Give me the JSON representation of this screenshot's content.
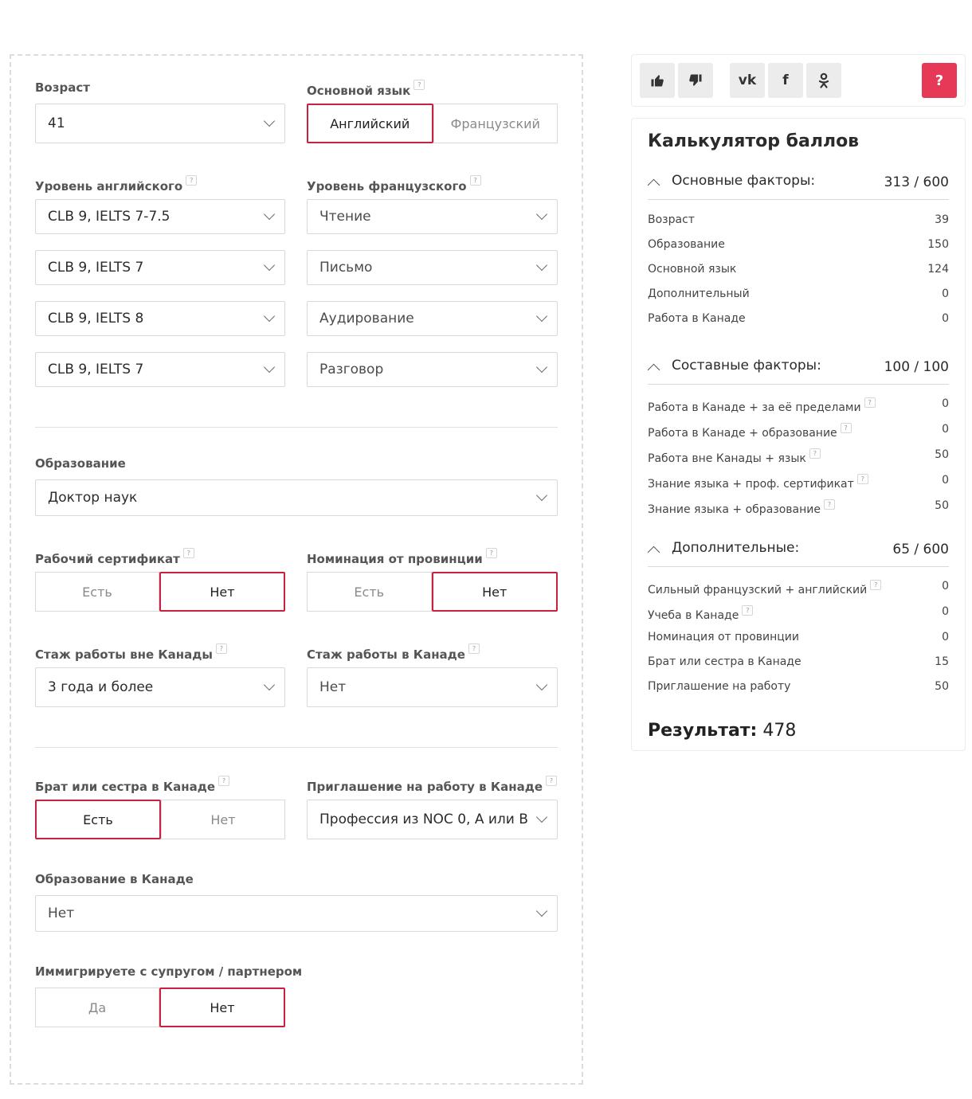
{
  "form": {
    "age": {
      "label": "Возраст",
      "value": "41"
    },
    "main_language": {
      "label": "Основной язык",
      "options": [
        "Английский",
        "Французский"
      ],
      "selected": "Английский"
    },
    "english_level": {
      "label": "Уровень английского",
      "values": [
        "CLB 9, IELTS 7-7.5",
        "CLB 9, IELTS 7",
        "CLB 9, IELTS 8",
        "CLB 9, IELTS 7"
      ]
    },
    "french_level": {
      "label": "Уровень французского",
      "values": [
        "Чтение",
        "Письмо",
        "Аудирование",
        "Разговор"
      ]
    },
    "education": {
      "label": "Образование",
      "value": "Доктор наук"
    },
    "work_certificate": {
      "label": "Рабочий сертификат",
      "options": [
        "Есть",
        "Нет"
      ],
      "selected": "Нет"
    },
    "provincial_nomination": {
      "label": "Номинация от провинции",
      "options": [
        "Есть",
        "Нет"
      ],
      "selected": "Нет"
    },
    "foreign_experience": {
      "label": "Стаж работы вне Канады",
      "value": "3 года и более"
    },
    "canadian_experience": {
      "label": "Стаж работы в Канаде",
      "value": "Нет"
    },
    "sibling_in_canada": {
      "label": "Брат или сестра в Канаде",
      "options": [
        "Есть",
        "Нет"
      ],
      "selected": "Есть"
    },
    "job_offer": {
      "label": "Приглашение на работу в Канаде",
      "value": "Профессия из NOC 0, A или B"
    },
    "canadian_education": {
      "label": "Образование в Канаде",
      "value": "Нет"
    },
    "spouse": {
      "label": "Иммигрируете с супругом / партнером",
      "options": [
        "Да",
        "Нет"
      ],
      "selected": "Нет"
    }
  },
  "toolbar": {
    "like_icon": "thumbs-up-icon",
    "dislike_icon": "thumbs-down-icon",
    "vk_label": "vk",
    "fb_label": "f",
    "ok_label": "ok",
    "help_label": "?"
  },
  "calculator": {
    "title": "Калькулятор баллов",
    "sections": [
      {
        "name": "Основные факторы:",
        "total": "313 / 600",
        "rows": [
          {
            "name": "Возраст",
            "value": "39"
          },
          {
            "name": "Образование",
            "value": "150"
          },
          {
            "name": "Основной язык",
            "value": "124"
          },
          {
            "name": "Дополнительный",
            "value": "0"
          },
          {
            "name": "Работа в Канаде",
            "value": "0"
          }
        ]
      },
      {
        "name": "Составные факторы:",
        "total": "100 / 100",
        "rows": [
          {
            "name": "Работа в Канаде + за её пределами",
            "value": "0"
          },
          {
            "name": "Работа в Канаде + образование",
            "value": "0"
          },
          {
            "name": "Работа вне Канады + язык",
            "value": "50"
          },
          {
            "name": "Знание языка + проф. сертификат",
            "value": "0"
          },
          {
            "name": "Знание языка + образование",
            "value": "50"
          }
        ]
      },
      {
        "name": "Дополнительные:",
        "total": "65 / 600",
        "rows": [
          {
            "name": "Сильный французский + английский",
            "value": "0"
          },
          {
            "name": "Учеба в Канаде",
            "value": "0"
          },
          {
            "name": "Номинация от провинции",
            "value": "0"
          },
          {
            "name": "Брат или сестра в Канаде",
            "value": "15"
          },
          {
            "name": "Приглашение на работу",
            "value": "50"
          }
        ]
      }
    ],
    "result_label": "Результат:",
    "result_value": "478"
  },
  "colors": {
    "accent": "#c8203f",
    "help_button": "#e63958"
  }
}
